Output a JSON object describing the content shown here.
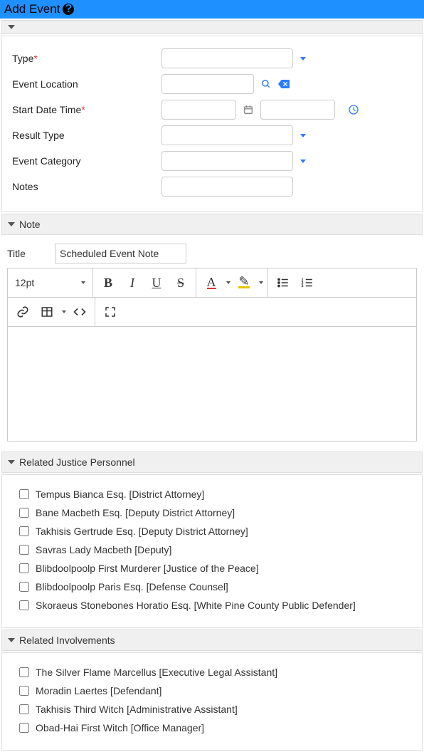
{
  "header": {
    "title": "Add Event"
  },
  "form": {
    "labels": {
      "type": "Type",
      "event_location": "Event Location",
      "start_date_time": "Start Date Time",
      "result_type": "Result Type",
      "event_category": "Event Category",
      "notes": "Notes"
    },
    "values": {
      "type": "",
      "event_location": "",
      "start_date": "",
      "start_time": "",
      "result_type": "",
      "event_category": "",
      "notes": ""
    }
  },
  "note_section": {
    "header": "Note",
    "title_label": "Title",
    "title_value": "Scheduled Event Note",
    "font_size": "12pt"
  },
  "personnel_section": {
    "header": "Related Justice Personnel",
    "items": [
      "Tempus Bianca Esq. [District Attorney]",
      "Bane Macbeth Esq. [Deputy District Attorney]",
      "Takhisis Gertrude Esq. [Deputy District Attorney]",
      "Savras Lady Macbeth [Deputy]",
      "Blibdoolpoolp First Murderer [Justice of the Peace]",
      "Blibdoolpoolp Paris Esq. [Defense Counsel]",
      "Skoraeus Stonebones Horatio Esq. [White Pine County Public Defender]"
    ]
  },
  "involvements_section": {
    "header": "Related Involvements",
    "items": [
      "The Silver Flame Marcellus [Executive Legal Assistant]",
      "Moradin Laertes [Defendant]",
      "Takhisis Third Witch [Administrative Assistant]",
      "Obad-Hai First Witch [Office Manager]"
    ]
  }
}
